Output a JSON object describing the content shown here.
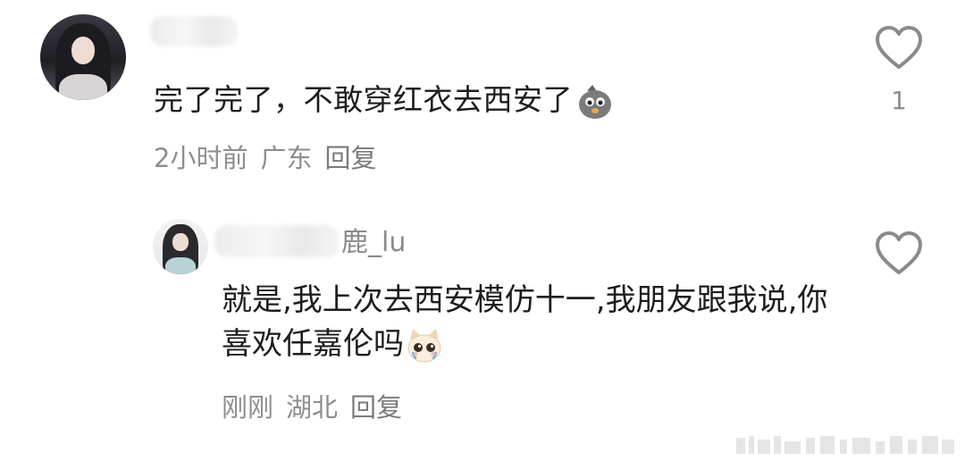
{
  "comments": [
    {
      "username_suffix": "",
      "text": "完了完了，不敢穿红衣去西安了",
      "emoji": "crying-bird-emoji",
      "time": "2小时前",
      "location": "广东",
      "reply_label": "回复",
      "like_count": "1"
    },
    {
      "username_suffix": "鹿_lu",
      "text": "就是,我上次去西安模仿十一,我朋友跟我说,你喜欢任嘉伦吗",
      "emoji": "teary-cat-emoji",
      "time": "刚刚",
      "location": "湖北",
      "reply_label": "回复",
      "like_count": ""
    }
  ],
  "colors": {
    "text": "#1d1d1d",
    "meta": "#8e8e8e",
    "heart_stroke": "#8a8a8a"
  }
}
